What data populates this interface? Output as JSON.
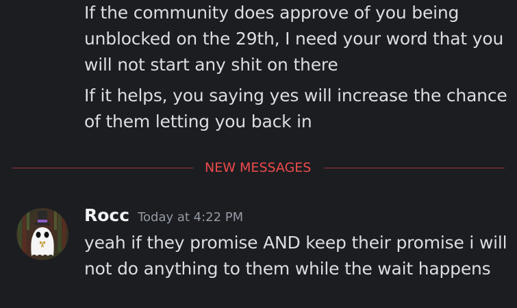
{
  "messages_above": {
    "message_1_lines": [
      "If the community does approve of you being",
      "unblocked on the 29th, I need your word that you",
      "will not start any shit on there"
    ],
    "message_2_lines": [
      "If it helps, you saying yes will increase the chance",
      "of them letting you back in"
    ]
  },
  "divider": {
    "label": "NEW MESSAGES",
    "color": "#f04b4b"
  },
  "new_message": {
    "author": "Rocc",
    "timestamp": "Today at 4:22 PM",
    "avatar_icon": "ghost-with-top-hat-icon",
    "lines": [
      "yeah if they promise AND keep their promise i will",
      "not do anything to them while the wait happens"
    ]
  },
  "colors": {
    "background": "#1c1d21",
    "text": "#dbdee1",
    "muted": "#949ba4",
    "new_messages_red": "#f04b4b"
  }
}
